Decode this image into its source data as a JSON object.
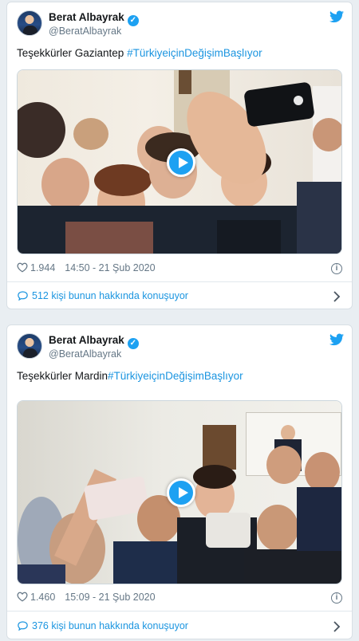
{
  "tweets": [
    {
      "author_name": "Berat Albayrak",
      "handle": "@BeratAlbayrak",
      "text_prefix": "Teşekkürler Gaziantep ",
      "hashtag": "#TürkiyeiçinDeğişimBaşlıyor",
      "likes": "1.944",
      "timestamp": "14:50 - 21 Şub 2020",
      "conversation": "512 kişi bunun hakkında konuşuyor"
    },
    {
      "author_name": "Berat Albayrak",
      "handle": "@BeratAlbayrak",
      "text_prefix": "Teşekkürler Mardin",
      "hashtag": "#TürkiyeiçinDeğişimBaşlıyor",
      "likes": "1.460",
      "timestamp": "15:09 - 21 Şub 2020",
      "conversation": "376 kişi bunun hakkında konuşuyor"
    }
  ],
  "icons": {
    "verified": "verified-badge-icon",
    "bird": "twitter-bird-icon",
    "play": "play-icon",
    "heart": "heart-icon",
    "info": "info-icon",
    "reply": "reply-bubble-icon",
    "chevron": "chevron-right-icon"
  },
  "colors": {
    "accent": "#1da1f2",
    "link": "#1b95e0",
    "muted": "#657786"
  }
}
